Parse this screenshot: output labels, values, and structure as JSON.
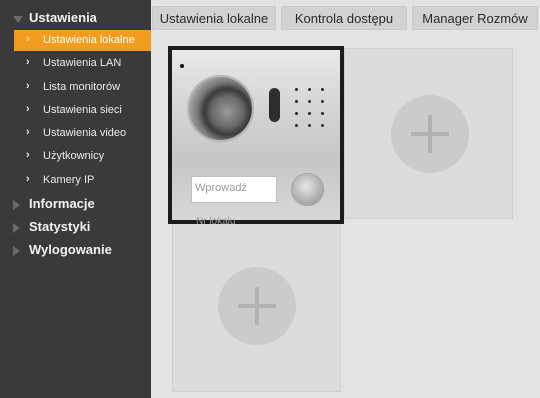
{
  "sidebar": {
    "sections": [
      {
        "label": "Ustawienia",
        "expanded": true
      },
      {
        "label": "Informacje",
        "expanded": false
      },
      {
        "label": "Statystyki",
        "expanded": false
      },
      {
        "label": "Wylogowanie",
        "expanded": false
      }
    ],
    "items": [
      {
        "label": "Ustawienia lokalne",
        "active": true
      },
      {
        "label": "Ustawienia LAN"
      },
      {
        "label": "Lista monitorów"
      },
      {
        "label": "Ustawienia sieci"
      },
      {
        "label": "Ustawienia video"
      },
      {
        "label": "Użytkownicy"
      },
      {
        "label": "Kamery IP"
      }
    ]
  },
  "tabs": [
    {
      "label": "Ustawienia lokalne"
    },
    {
      "label": "Kontrola dostępu"
    },
    {
      "label": "Manager Rozmów"
    }
  ],
  "device": {
    "input_placeholder": "Wprowadź",
    "caption": "Nr lokalu"
  },
  "colors": {
    "accent": "#f39d1e",
    "sidebar_bg": "#3a3a3a",
    "content_bg": "#e3e3e3"
  }
}
